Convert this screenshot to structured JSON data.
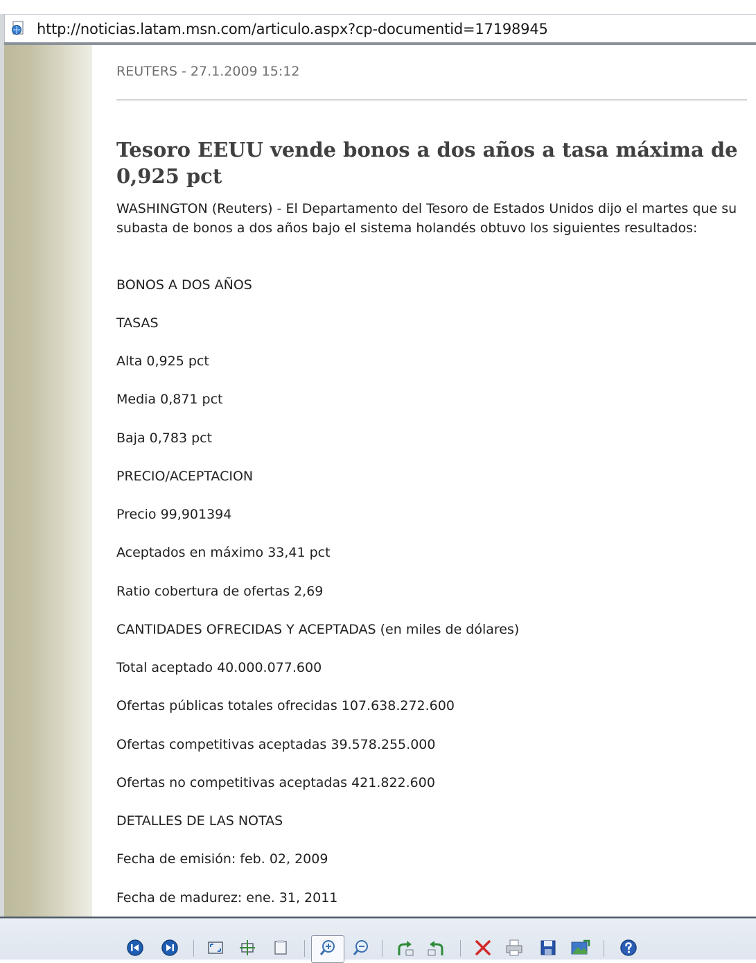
{
  "address_bar": {
    "url": "http://noticias.latam.msn.com/articulo.aspx?cp-documentid=17198945"
  },
  "article": {
    "source_line": "REUTERS - 27.1.2009 15:12",
    "headline": "Tesoro EEUU vende bonos a dos años a tasa máxima de 0,925 pct",
    "intro": "WASHINGTON (Reuters) - El Departamento del Tesoro de Estados Unidos dijo el martes que su subasta de bonos a dos años bajo el sistema holandés obtuvo los siguientes resultados:",
    "lines": [
      "BONOS A DOS AÑOS",
      "TASAS",
      "Alta 0,925 pct",
      "Media 0,871 pct",
      "Baja 0,783 pct",
      "PRECIO/ACEPTACION",
      "Precio 99,901394",
      "Aceptados en máximo 33,41 pct",
      "Ratio cobertura de ofertas 2,69",
      "CANTIDADES OFRECIDAS Y ACEPTADAS (en miles de dólares)",
      "Total aceptado 40.000.077.600",
      "Ofertas públicas totales ofrecidas 107.638.272.600",
      "Ofertas competitivas aceptadas 39.578.255.000",
      "Ofertas no competitivas aceptadas 421.822.600",
      "DETALLES DE LAS NOTAS",
      "Fecha de emisión: feb. 02, 2009",
      "Fecha de madurez: ene. 31, 2011"
    ]
  },
  "toolbar": {
    "icons": [
      "previous-icon",
      "next-icon",
      "best-fit-icon",
      "actual-size-icon",
      "slideshow-icon",
      "zoom-in-icon",
      "zoom-out-icon",
      "rotate-clockwise-icon",
      "rotate-counterclockwise-icon",
      "delete-icon",
      "print-icon",
      "save-icon",
      "open-icon",
      "help-icon"
    ]
  },
  "colors": {
    "sidebar": "#c4c1a6",
    "headline": "#404040",
    "source": "#6f6f6f",
    "toolbar_bg": "#dfe6ef",
    "nav_blue": "#1f5fb3",
    "delete_red": "#d12a2a"
  }
}
